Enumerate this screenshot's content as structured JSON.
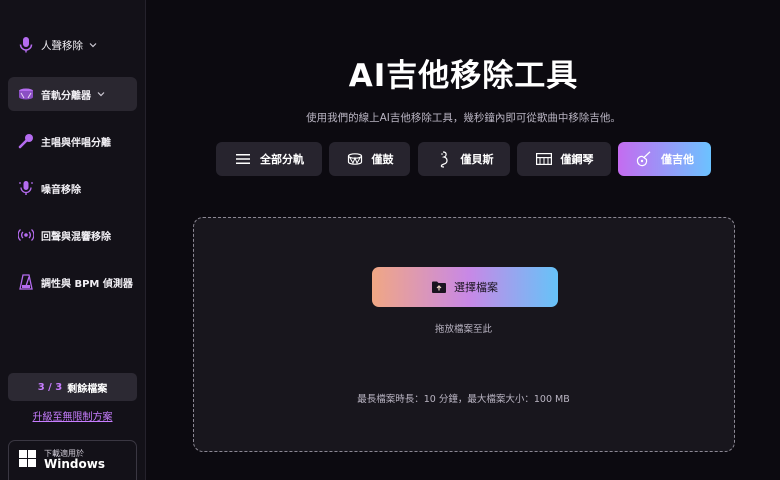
{
  "sidebar": {
    "items": [
      {
        "label": "人聲移除",
        "icon": "microphone-icon"
      },
      {
        "label": "音軌分離器",
        "icon": "drum-icon"
      },
      {
        "label": "主唱與伴唱分離",
        "icon": "karaoke-mic-icon"
      },
      {
        "label": "噪音移除",
        "icon": "noise-mic-icon"
      },
      {
        "label": "回聲與混響移除",
        "icon": "broadcast-icon"
      },
      {
        "label": "調性與 BPM 偵測器",
        "icon": "metronome-icon"
      }
    ],
    "quota": {
      "count": "3 / 3",
      "text": "剩餘檔案"
    },
    "upgrade_link": "升級至無限制方案",
    "download": {
      "small": "下載適用於",
      "big": "Windows"
    }
  },
  "main": {
    "title": "AI吉他移除工具",
    "subtitle": "使用我們的線上AI吉他移除工具，幾秒鐘內即可從歌曲中移除吉他。",
    "tabs": [
      {
        "label": "全部分軌",
        "icon": "menu-lines-icon",
        "active": false
      },
      {
        "label": "僅鼓",
        "icon": "drum-icon",
        "active": false
      },
      {
        "label": "僅貝斯",
        "icon": "bass-icon",
        "active": false
      },
      {
        "label": "僅鋼琴",
        "icon": "piano-icon",
        "active": false
      },
      {
        "label": "僅吉他",
        "icon": "guitar-icon",
        "active": true
      }
    ],
    "dropzone": {
      "button_label": "選擇檔案",
      "hint": "拖放檔案至此",
      "limits": "最長檔案時長：10 分鐘，最大檔案大小：100 MB"
    }
  },
  "colors": {
    "accent_purple": "#c77dff",
    "background": "#0c0a10",
    "sidebar_bg": "#131118",
    "tab_bg": "#27242e"
  }
}
